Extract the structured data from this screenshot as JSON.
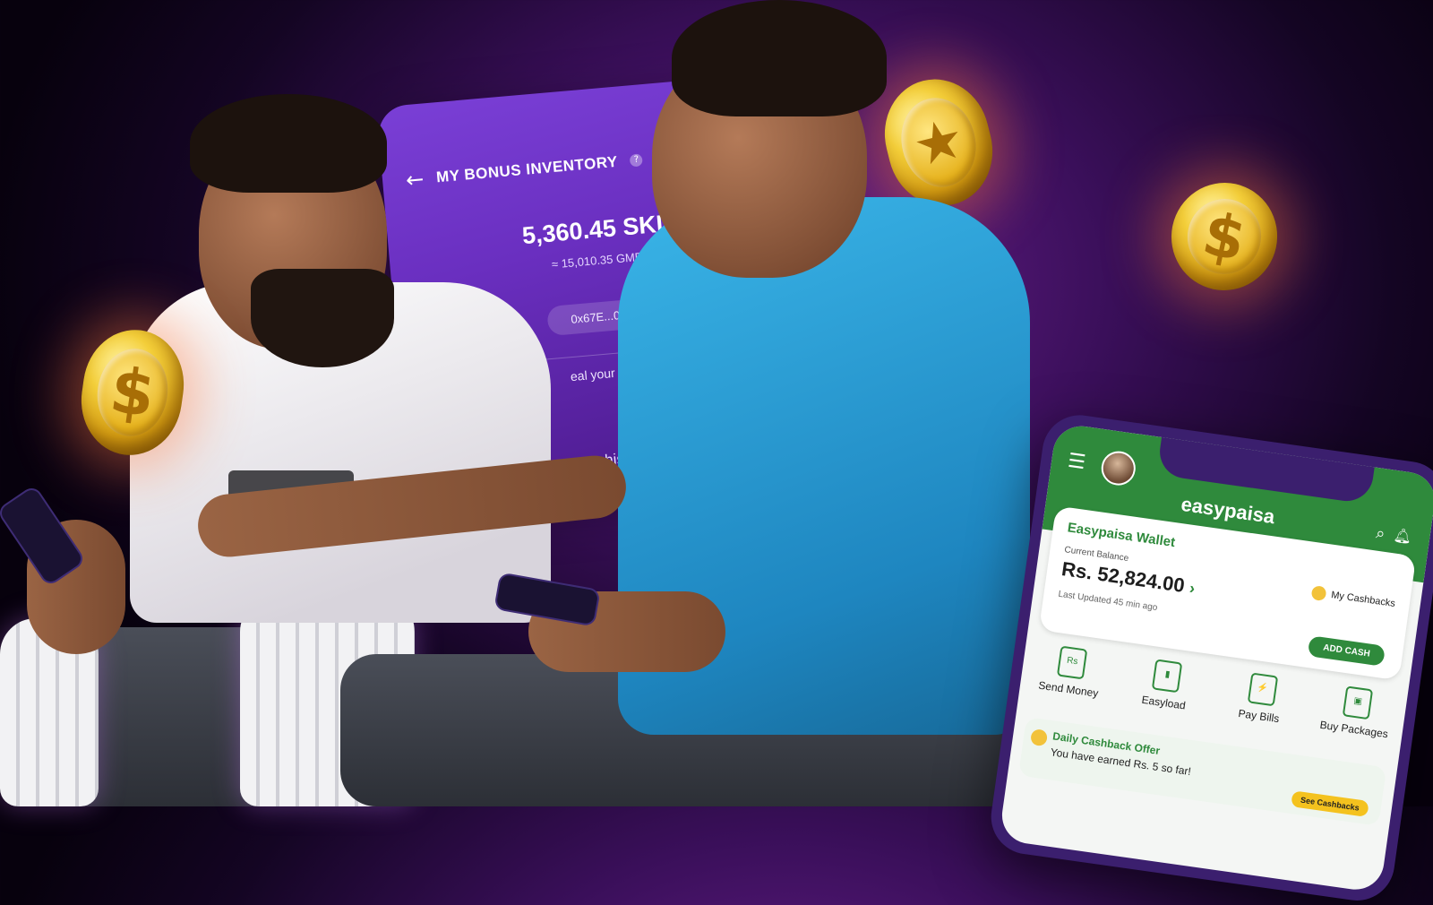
{
  "bonus_inventory": {
    "title": "MY BONUS INVENTORY",
    "back_icon": "arrow-left-icon",
    "help_icon": "question-icon",
    "amount": "5,360.45 SKL",
    "approx": "≈ 15,010.35 GMF",
    "address": "0x67E...0e87",
    "reveal_text": "eal your Secret Priva",
    "history_text": "history"
  },
  "easypaisa": {
    "brand": "easypaisa",
    "wallet_title": "Easypaisa Wallet",
    "balance_label": "Current Balance",
    "balance": "Rs. 52,824.00",
    "last_updated": "Last Updated 45 min ago",
    "my_cashbacks": "My Cashbacks",
    "add_cash": "ADD CASH",
    "actions": [
      {
        "label": "Send Money",
        "icon": "send-money-icon",
        "glyph": "Rs"
      },
      {
        "label": "Easyload",
        "icon": "mobile-icon",
        "glyph": "▮"
      },
      {
        "label": "Pay Bills",
        "icon": "bill-icon",
        "glyph": "⚡"
      },
      {
        "label": "Buy Packages",
        "icon": "package-icon",
        "glyph": "▣"
      }
    ],
    "offer_title": "Daily Cashback Offer",
    "offer_text": "You have  earned Rs. 5 so far!",
    "see_cashbacks": "See Cashbacks"
  },
  "colors": {
    "bg_purple": "#3a0f5a",
    "card_purple": "#6a2fc0",
    "easypaisa_green": "#2f8a3c",
    "coin_gold": "#f4cf3a"
  }
}
